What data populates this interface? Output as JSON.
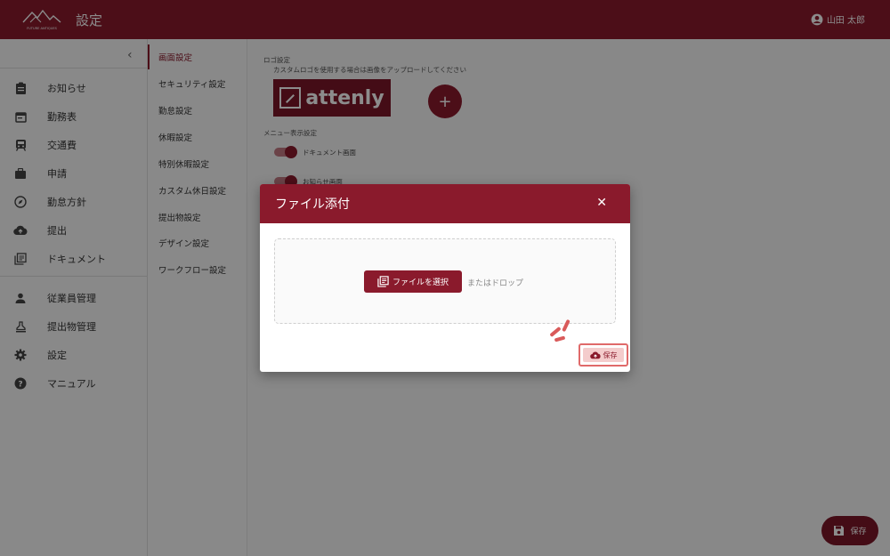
{
  "header": {
    "logo_text": "FUTURE ANTIQUES",
    "title": "設定",
    "user_name": "山田 太郎"
  },
  "sidebar": {
    "items": [
      {
        "label": "お知らせ",
        "icon": "clipboard-icon"
      },
      {
        "label": "勤務表",
        "icon": "calendar-icon"
      },
      {
        "label": "交通費",
        "icon": "train-icon"
      },
      {
        "label": "申請",
        "icon": "briefcase-icon"
      },
      {
        "label": "勤怠方針",
        "icon": "compass-icon"
      },
      {
        "label": "提出",
        "icon": "cloud-upload-icon"
      },
      {
        "label": "ドキュメント",
        "icon": "library-icon"
      }
    ],
    "admin_items": [
      {
        "label": "従業員管理",
        "icon": "person-icon"
      },
      {
        "label": "提出物管理",
        "icon": "stamp-icon"
      },
      {
        "label": "設定",
        "icon": "gear-icon"
      },
      {
        "label": "マニュアル",
        "icon": "help-icon"
      }
    ]
  },
  "submenu": {
    "items": [
      "画面設定",
      "セキュリティ設定",
      "勤怠設定",
      "休暇設定",
      "特別休暇設定",
      "カスタム休日設定",
      "提出物設定",
      "デザイン設定",
      "ワークフロー設定"
    ]
  },
  "main": {
    "logo_section_label": "ロゴ設定",
    "logo_section_hint": "カスタムロゴを使用する場合は画像をアップロードしてください",
    "logo_preview_text": "attenly",
    "add_label": "+",
    "menu_section_label": "メニュー表示設定",
    "toggles": [
      "ドキュメント画面",
      "お知らせ画面"
    ],
    "save_label": "保存"
  },
  "modal": {
    "title": "ファイル添付",
    "close_label": "✕",
    "select_file_label": "ファイルを選択",
    "or_drop_label": "またはドロップ",
    "save_label": "保存"
  },
  "colors": {
    "brand": "#8a1a2c",
    "highlight": "#e06a6a"
  }
}
